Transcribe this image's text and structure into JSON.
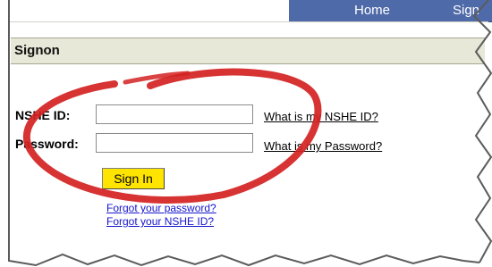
{
  "nav": {
    "home": "Home",
    "sign": "Sign"
  },
  "section": {
    "title": "Signon"
  },
  "form": {
    "nshe_label": "NSHE ID:",
    "nshe_value": "",
    "password_label": "Password:",
    "password_value": "",
    "help_nshe": "What is my NSHE ID?",
    "help_password": "What is my Password?",
    "signin_label": "Sign In",
    "forgot_password": "Forgot your password?",
    "forgot_nshe": "Forgot your NSHE ID?"
  },
  "colors": {
    "nav_bg": "#4f6aa8",
    "signin_bg": "#ffe400",
    "annotation": "#d42222",
    "link": "#1515cc"
  },
  "icons": {
    "annotation": "red-circle-annotation-icon"
  }
}
